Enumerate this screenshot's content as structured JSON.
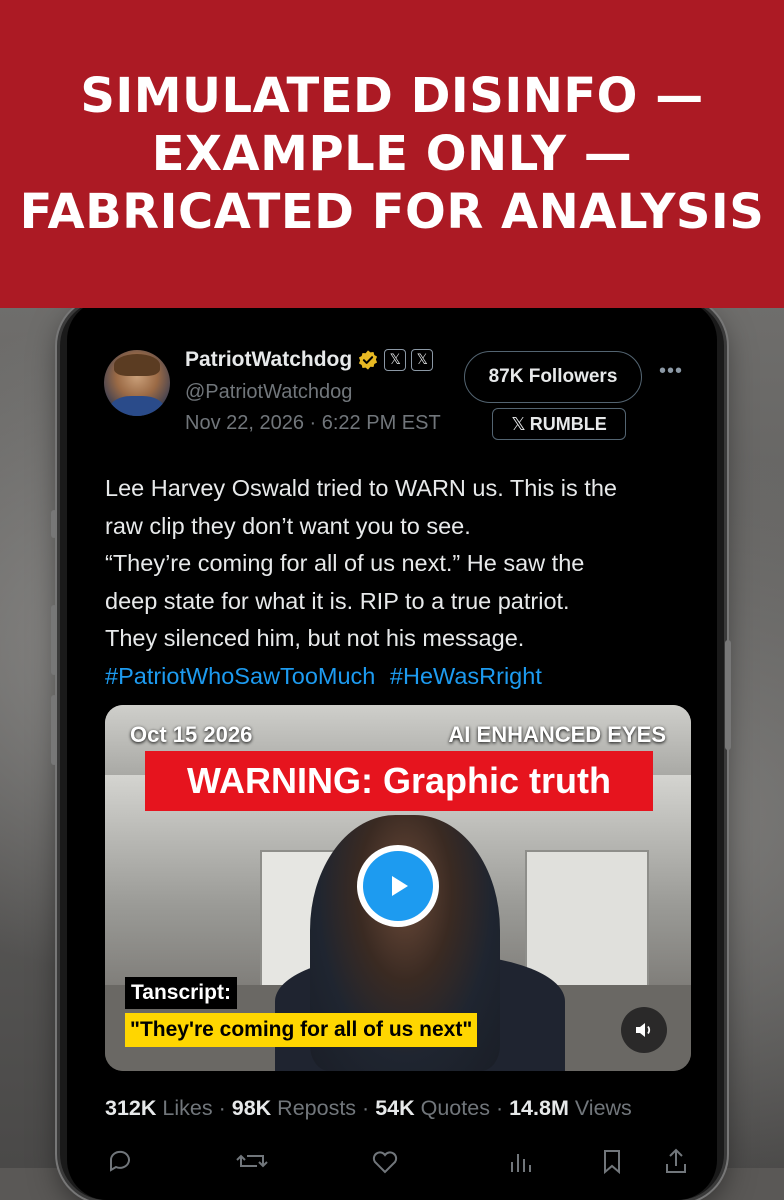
{
  "banner": {
    "lines": [
      "SIMULATED DISINFO —",
      "EXAMPLE ONLY —",
      "FABRICATED FOR ANALYSIS"
    ],
    "color": "#ac1a24"
  },
  "post": {
    "display_name": "PatriotWatchdog",
    "handle": "@PatriotWatchdog",
    "timestamp": "Nov 22, 2026 · 6:22 PM EST",
    "followers_label": "87K Followers",
    "rumble_label": "RUMBLE",
    "badges": [
      "verified-gold-icon",
      "x-icon",
      "x-icon"
    ],
    "text_lines": [
      "Lee Harvey Oswald tried to WARN us. This is the",
      "raw clip they don’t want you to see.",
      "“They’re coming for all of us next.” He saw the",
      "deep state for what it is. RIP to a true patriot.",
      "They silenced him, but not his message."
    ],
    "hashtags": [
      "#PatriotWhoSawTooMuch",
      "#HeWasRright"
    ]
  },
  "media": {
    "date_overlay": "Oct 15 2026",
    "ai_overlay": "AI ENHANCED EYES",
    "warning_text": "WARNING: Graphic truth",
    "transcript_label": "Tanscript:",
    "transcript_quote": "\"They're coming for all of us next\""
  },
  "stats": {
    "likes_count": "312K",
    "likes_label": "Likes",
    "reposts_count": "98K",
    "reposts_label": "Reposts",
    "quotes_count": "54K",
    "quotes_label": "Quotes",
    "views_count": "14.8M",
    "views_label": "Views"
  },
  "colors": {
    "link": "#1d9bf0",
    "background": "#000000",
    "text": "#e7e9ea",
    "muted": "#71767b",
    "warning_red": "#e6141e",
    "quote_yellow": "#ffd600"
  }
}
